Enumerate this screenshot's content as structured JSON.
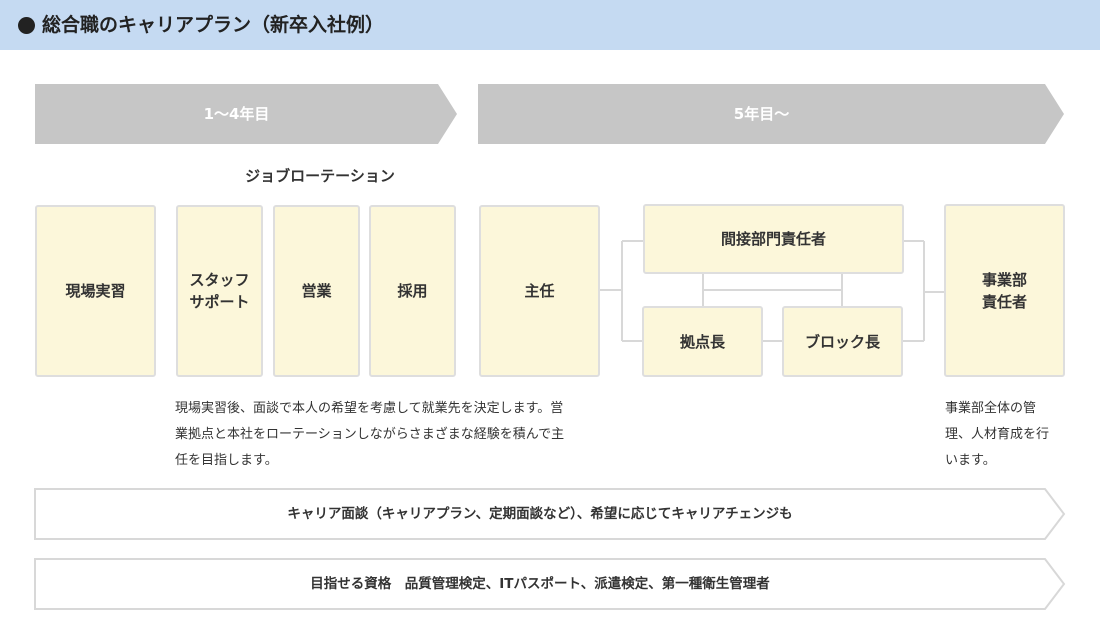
{
  "header": {
    "title": "総合職のキャリアプラン（新卒入社例）"
  },
  "phases": [
    {
      "label": "1〜4年目"
    },
    {
      "label": "5年目〜"
    }
  ],
  "rotation_label": "ジョブローテーション",
  "boxes": {
    "genba": "現場実習",
    "staff_support": [
      "スタッフ",
      "サポート"
    ],
    "eigyo": "営業",
    "saiyo": "採用",
    "shunin": "主任",
    "kansetsu": "間接部門責任者",
    "kyoten": "拠点長",
    "block": "ブロック長",
    "jigyobu": [
      "事業部",
      "責任者"
    ]
  },
  "descriptions": {
    "rotation": [
      "現場実習後、面談で本人の希望を考慮して就業先を決定します。営",
      "業拠点と本社をローテーションしながらさまざまな経験を積んで主",
      "任を目指します。"
    ],
    "jigyobu": [
      "事業部全体の管",
      "理、人材育成を行",
      "います。"
    ]
  },
  "banners": {
    "career": "キャリア面談（キャリアプラン、定期面談など）、希望に応じてキャリアチェンジも",
    "qualifications": "目指せる資格　品質管理検定、ITパスポート、派遣検定、第一種衛生管理者"
  },
  "colors": {
    "header_bg": "#c5daf2",
    "phase_arrow": "#c6c6c6",
    "box_fill": "#fcf7da",
    "box_border": "#dedede",
    "connector": "#d8d8d8"
  }
}
